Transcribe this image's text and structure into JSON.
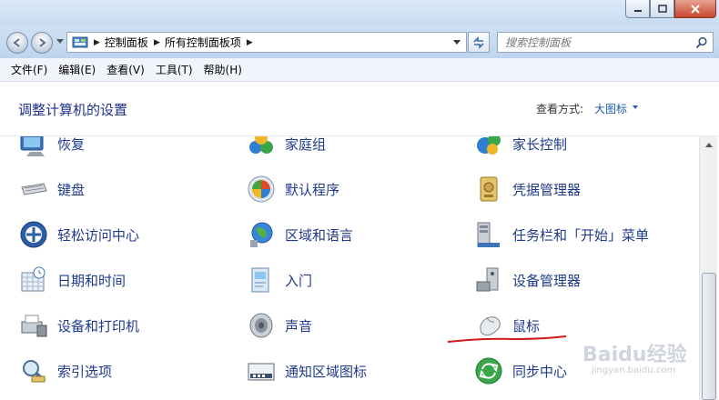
{
  "address": {
    "crumbs": [
      "控制面板",
      "所有控制面板项"
    ]
  },
  "search": {
    "placeholder": "搜索控制面板"
  },
  "menu": [
    "文件(F)",
    "编辑(E)",
    "查看(V)",
    "工具(T)",
    "帮助(H)"
  ],
  "content": {
    "heading": "调整计算机的设置",
    "view_by_label": "查看方式:",
    "view_by_value": "大图标"
  },
  "items": [
    {
      "label": "恢复",
      "icon": "recovery-icon"
    },
    {
      "label": "家庭组",
      "icon": "homegroup-icon"
    },
    {
      "label": "家长控制",
      "icon": "parental-controls-icon"
    },
    {
      "label": "键盘",
      "icon": "keyboard-icon"
    },
    {
      "label": "默认程序",
      "icon": "default-programs-icon"
    },
    {
      "label": "凭据管理器",
      "icon": "credential-manager-icon"
    },
    {
      "label": "轻松访问中心",
      "icon": "ease-of-access-icon"
    },
    {
      "label": "区域和语言",
      "icon": "region-language-icon"
    },
    {
      "label": "任务栏和「开始」菜单",
      "icon": "taskbar-icon"
    },
    {
      "label": "日期和时间",
      "icon": "date-time-icon"
    },
    {
      "label": "入门",
      "icon": "getting-started-icon"
    },
    {
      "label": "设备管理器",
      "icon": "device-manager-icon"
    },
    {
      "label": "设备和打印机",
      "icon": "devices-printers-icon"
    },
    {
      "label": "声音",
      "icon": "sound-icon"
    },
    {
      "label": "鼠标",
      "icon": "mouse-icon"
    },
    {
      "label": "索引选项",
      "icon": "indexing-options-icon"
    },
    {
      "label": "通知区域图标",
      "icon": "notification-area-icon"
    },
    {
      "label": "同步中心",
      "icon": "sync-center-icon"
    }
  ],
  "watermark": {
    "text": "Baidu经验",
    "sub": "jingyan.baidu.com"
  },
  "colors": {
    "link": "#1f3a8a",
    "heading": "#1e3287",
    "annotation": "#d01818"
  }
}
